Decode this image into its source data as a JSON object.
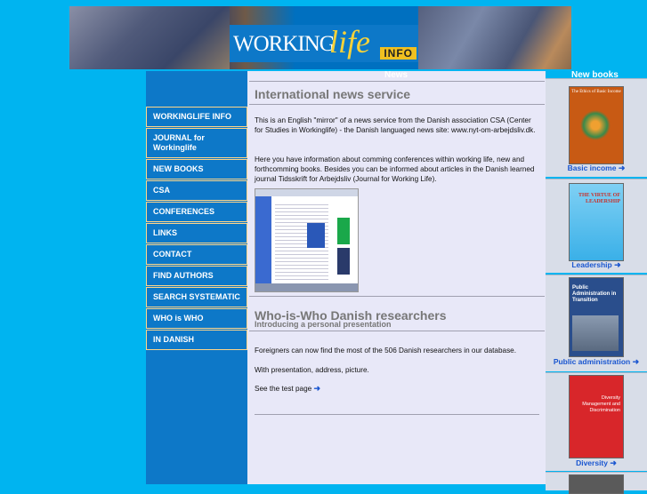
{
  "banner": {
    "logo_working": "WORKING",
    "logo_life": "life",
    "logo_info": "INFO"
  },
  "labels": {
    "news": "News",
    "new_books": "New books"
  },
  "menu": [
    "WORKINGLIFE INFO",
    "JOURNAL for Workinglife",
    "NEW BOOKS",
    "CSA",
    "CONFERENCES",
    "LINKS",
    "CONTACT",
    "FIND AUTHORS",
    "SEARCH SYSTEMATIC",
    "WHO is WHO",
    "IN DANISH"
  ],
  "news": {
    "title": "International news service",
    "para1": "This is an English \"mirror\" of a news service from the Danish association CSA (Center for Studies in Workinglife) - the Danish languaged news site: www.nyt-om-arbejdsliv.dk.",
    "para2": "Here you have information about comming conferences within working life, new and forthcomming books. Besides you can be informed about articles in the Danish learned journal Tidsskrift for Arbejdsliv (Journal for Working Life)."
  },
  "who": {
    "title": "Who-is-Who Danish researchers",
    "subtitle": "Introducing a personal presentation",
    "para1": "Foreigners can now find the most of the 506 Danish researchers in our database.",
    "para2": "With presentation, address, picture.",
    "link": "See the test page"
  },
  "books": [
    {
      "caption": "Basic income",
      "cover_title": "The Ethics of Basic Income",
      "color": "#c85a14"
    },
    {
      "caption": "Leadership",
      "cover_title": "THE VIRTUE OF LEADERSHIP",
      "color": "#3ab0e8"
    },
    {
      "caption": "Public administration",
      "cover_title": "Public Administration in Transition",
      "color": "#2a4e8c"
    },
    {
      "caption": "Diversity",
      "cover_title": "Diversity Management and Discrimination",
      "color": "#d8262a"
    }
  ],
  "colors": {
    "page_bg": "#00b4f0",
    "nav_bg": "#0d78c8",
    "menu_border": "#ffd68a",
    "content_bg": "#e8e8f8",
    "link": "#1a56d0"
  }
}
